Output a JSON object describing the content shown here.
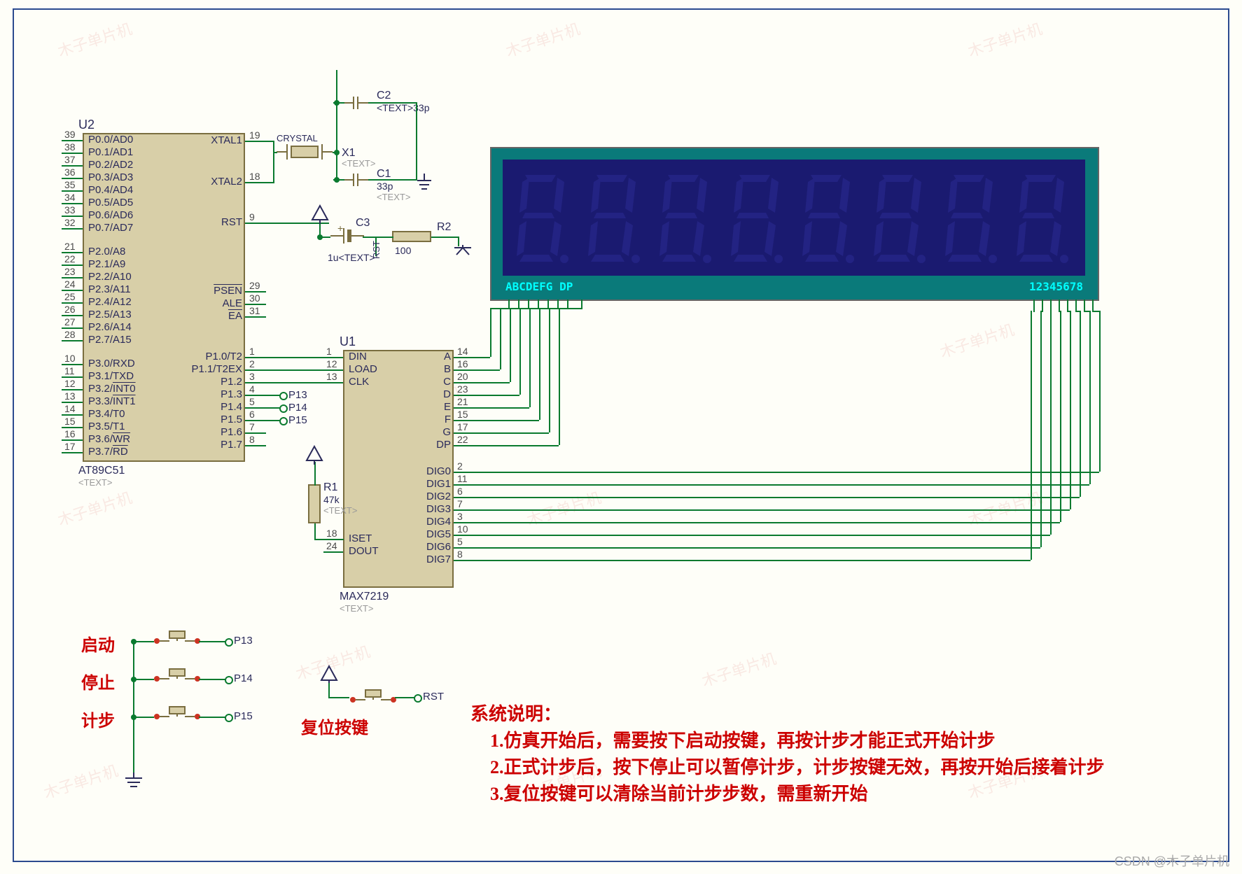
{
  "schematic": {
    "mcu": {
      "ref": "U2",
      "part": "AT89C51",
      "text_placeholder": "<TEXT>",
      "left_pins": [
        {
          "num": "39",
          "name": "P0.0/AD0"
        },
        {
          "num": "38",
          "name": "P0.1/AD1"
        },
        {
          "num": "37",
          "name": "P0.2/AD2"
        },
        {
          "num": "36",
          "name": "P0.3/AD3"
        },
        {
          "num": "35",
          "name": "P0.4/AD4"
        },
        {
          "num": "34",
          "name": "P0.5/AD5"
        },
        {
          "num": "33",
          "name": "P0.6/AD6"
        },
        {
          "num": "32",
          "name": "P0.7/AD7"
        },
        {
          "num": "21",
          "name": "P2.0/A8"
        },
        {
          "num": "22",
          "name": "P2.1/A9"
        },
        {
          "num": "23",
          "name": "P2.2/A10"
        },
        {
          "num": "24",
          "name": "P2.3/A11"
        },
        {
          "num": "25",
          "name": "P2.4/A12"
        },
        {
          "num": "26",
          "name": "P2.5/A13"
        },
        {
          "num": "27",
          "name": "P2.6/A14"
        },
        {
          "num": "28",
          "name": "P2.7/A15"
        },
        {
          "num": "10",
          "name": "P3.0/RXD"
        },
        {
          "num": "11",
          "name": "P3.1/TXD"
        },
        {
          "num": "12",
          "name": "P3.2/INT0",
          "overline_part": "INT0"
        },
        {
          "num": "13",
          "name": "P3.3/INT1",
          "overline_part": "INT1"
        },
        {
          "num": "14",
          "name": "P3.4/T0"
        },
        {
          "num": "15",
          "name": "P3.5/T1"
        },
        {
          "num": "16",
          "name": "P3.6/WR",
          "overline_part": "WR"
        },
        {
          "num": "17",
          "name": "P3.7/RD",
          "overline_part": "RD"
        }
      ],
      "right_pins": [
        {
          "num": "19",
          "name": "XTAL1"
        },
        {
          "num": "18",
          "name": "XTAL2"
        },
        {
          "num": "9",
          "name": "RST"
        },
        {
          "num": "29",
          "name": "PSEN",
          "overline": true
        },
        {
          "num": "30",
          "name": "ALE"
        },
        {
          "num": "31",
          "name": "EA",
          "overline": true
        },
        {
          "num": "1",
          "name": "P1.0/T2"
        },
        {
          "num": "2",
          "name": "P1.1/T2EX"
        },
        {
          "num": "3",
          "name": "P1.2"
        },
        {
          "num": "4",
          "name": "P1.3"
        },
        {
          "num": "5",
          "name": "P1.4"
        },
        {
          "num": "6",
          "name": "P1.5"
        },
        {
          "num": "7",
          "name": "P1.6"
        },
        {
          "num": "8",
          "name": "P1.7"
        }
      ]
    },
    "driver": {
      "ref": "U1",
      "part": "MAX7219",
      "text_placeholder": "<TEXT>",
      "left_pins": [
        {
          "num": "1",
          "name": "DIN"
        },
        {
          "num": "12",
          "name": "LOAD"
        },
        {
          "num": "13",
          "name": "CLK"
        },
        {
          "num": "18",
          "name": "ISET"
        },
        {
          "num": "24",
          "name": "DOUT"
        }
      ],
      "right_pins": [
        {
          "num": "14",
          "name": "A"
        },
        {
          "num": "16",
          "name": "B"
        },
        {
          "num": "20",
          "name": "C"
        },
        {
          "num": "23",
          "name": "D"
        },
        {
          "num": "21",
          "name": "E"
        },
        {
          "num": "15",
          "name": "F"
        },
        {
          "num": "17",
          "name": "G"
        },
        {
          "num": "22",
          "name": "DP"
        },
        {
          "num": "2",
          "name": "DIG0"
        },
        {
          "num": "11",
          "name": "DIG1"
        },
        {
          "num": "6",
          "name": "DIG2"
        },
        {
          "num": "7",
          "name": "DIG3"
        },
        {
          "num": "3",
          "name": "DIG4"
        },
        {
          "num": "10",
          "name": "DIG5"
        },
        {
          "num": "5",
          "name": "DIG6"
        },
        {
          "num": "8",
          "name": "DIG7"
        }
      ]
    },
    "crystal": {
      "ref": "X1",
      "label": "CRYSTAL",
      "text_placeholder": "<TEXT>"
    },
    "caps": {
      "c1": {
        "ref": "C1",
        "value": "33p",
        "text_placeholder": "<TEXT>"
      },
      "c2": {
        "ref": "C2",
        "value": "33p",
        "text_placeholder": "<TEXT>"
      },
      "c3": {
        "ref": "C3",
        "value": "1u",
        "text_placeholder": "<TEXT>"
      }
    },
    "resistors": {
      "r1": {
        "ref": "R1",
        "value": "47k",
        "text_placeholder": "<TEXT>"
      },
      "r2": {
        "ref": "R2",
        "value": "100"
      }
    },
    "display": {
      "seg_label": "ABCDEFG DP",
      "dig_label": "12345678"
    },
    "nets": {
      "p13": "P13",
      "p14": "P14",
      "p15": "P15",
      "rst": "RST"
    },
    "buttons": {
      "start": "启动",
      "stop": "停止",
      "step": "计步",
      "reset": "复位按键"
    },
    "notes": {
      "title": "系统说明：",
      "line1": "1.仿真开始后，需要按下启动按键，再按计步才能正式开始计步",
      "line2": "2.正式计步后，按下停止可以暂停计步，计步按键无效，再按开始后接着计步",
      "line3": "3.复位按键可以清除当前计步步数，需重新开始"
    },
    "watermark_text": "木子单片机",
    "footer": "CSDN @木子单片机"
  }
}
